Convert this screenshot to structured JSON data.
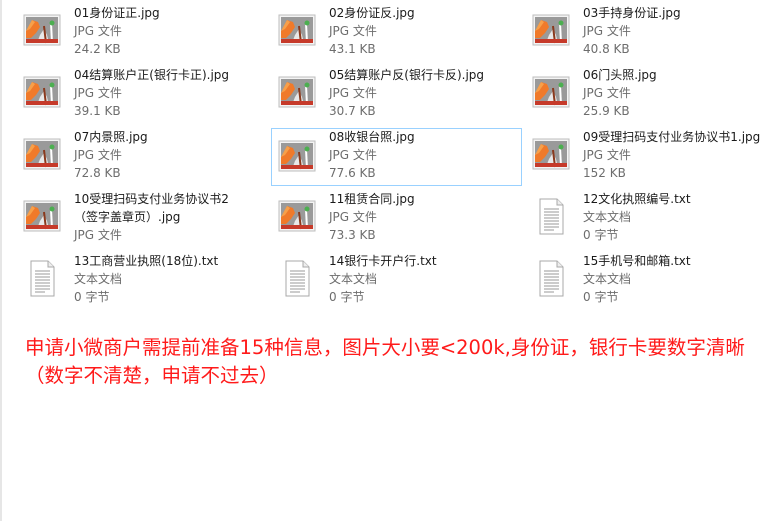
{
  "files": [
    {
      "name": "01身份证正.jpg",
      "type": "JPG 文件",
      "size": "24.2 KB",
      "icon": "image-icon"
    },
    {
      "name": "02身份证反.jpg",
      "type": "JPG 文件",
      "size": "43.1 KB",
      "icon": "image-icon"
    },
    {
      "name": "03手持身份证.jpg",
      "type": "JPG 文件",
      "size": "40.8 KB",
      "icon": "image-icon"
    },
    {
      "name": "04结算账户正(银行卡正).jpg",
      "type": "JPG 文件",
      "size": "39.1 KB",
      "icon": "image-icon"
    },
    {
      "name": "05结算账户反(银行卡反).jpg",
      "type": "JPG 文件",
      "size": "30.7 KB",
      "icon": "image-icon"
    },
    {
      "name": "06门头照.jpg",
      "type": "JPG 文件",
      "size": "25.9 KB",
      "icon": "image-icon"
    },
    {
      "name": "07内景照.jpg",
      "type": "JPG 文件",
      "size": "72.8 KB",
      "icon": "image-icon"
    },
    {
      "name": "08收银台照.jpg",
      "type": "JPG 文件",
      "size": "77.6 KB",
      "icon": "image-icon"
    },
    {
      "name": "09受理扫码支付业务协议书1.jpg",
      "type": "JPG 文件",
      "size": "152 KB",
      "icon": "image-icon"
    },
    {
      "name": "10受理扫码支付业务协议书2（签字盖章页）.jpg",
      "type": "JPG 文件",
      "size": "",
      "icon": "image-icon"
    },
    {
      "name": "11租赁合同.jpg",
      "type": "JPG 文件",
      "size": "73.3 KB",
      "icon": "image-icon"
    },
    {
      "name": "12文化执照编号.txt",
      "type": "文本文档",
      "size": "0 字节",
      "icon": "text-file-icon"
    },
    {
      "name": "13工商营业执照(18位).txt",
      "type": "文本文档",
      "size": "0 字节",
      "icon": "text-file-icon"
    },
    {
      "name": "14银行卡开户行.txt",
      "type": "文本文档",
      "size": "0 字节",
      "icon": "text-file-icon"
    },
    {
      "name": "15手机号和邮箱.txt",
      "type": "文本文档",
      "size": "0 字节",
      "icon": "text-file-icon"
    }
  ],
  "selected_file": "08收银台照.jpg",
  "note": "申请小微商户需提前准备15种信息，图片大小要<200k,身份证，银行卡要数字清晰（数字不清楚，申请不过去）",
  "colors": {
    "note": "#ff1a1a",
    "selection_border": "#99d1ff"
  }
}
